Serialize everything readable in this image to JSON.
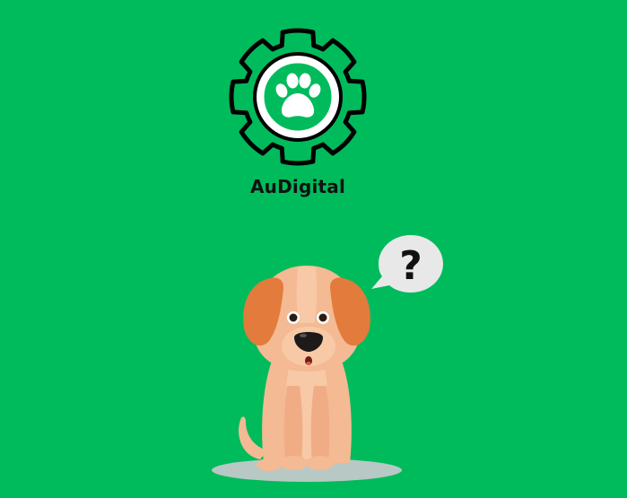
{
  "brand": {
    "name": "AuDigital",
    "logo_icon": "gear-paw-icon",
    "colors": {
      "background": "#00bb5c",
      "logo_stroke": "#000000",
      "logo_fill": "#ffffff"
    }
  },
  "illustration": {
    "icon": "confused-dog-icon",
    "bubble_text": "?",
    "colors": {
      "dog_body": "#f4ba93",
      "dog_ears": "#e37b3c",
      "bubble": "#e8e8e8",
      "shadow": "#b8c8c4"
    }
  }
}
